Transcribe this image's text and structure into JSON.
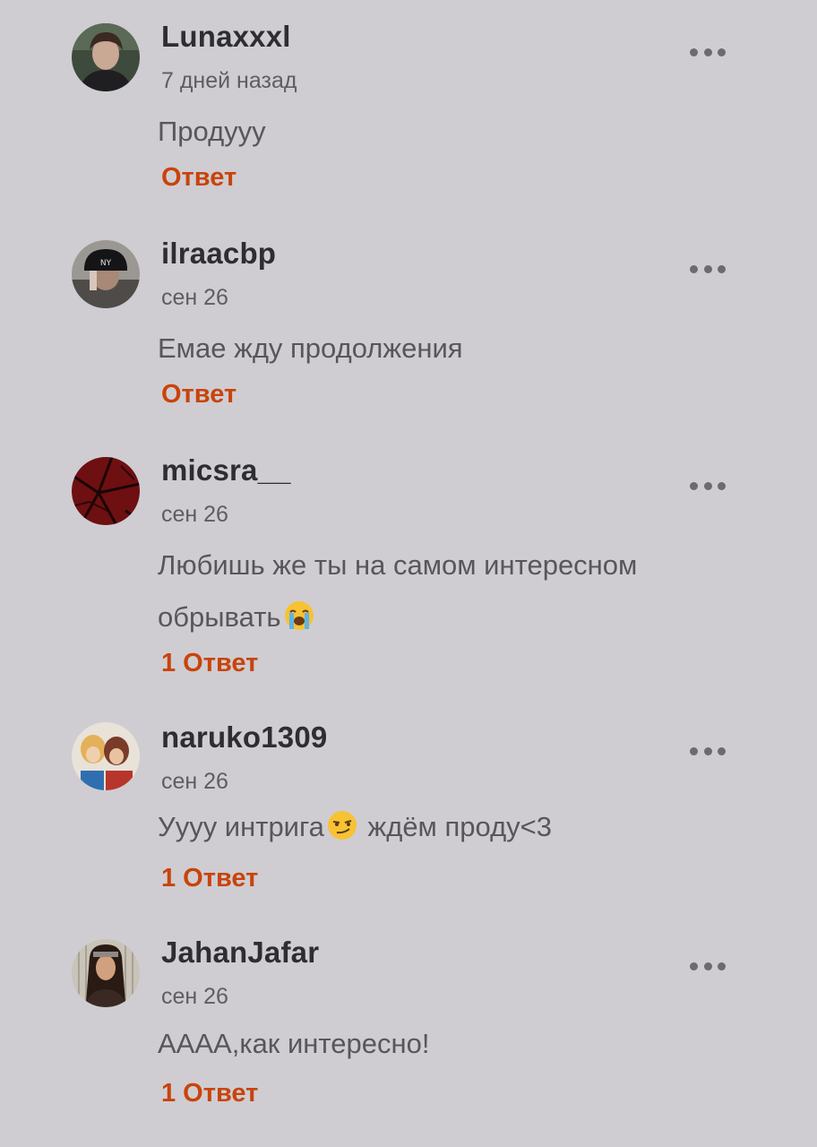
{
  "comments": [
    {
      "username": "Lunaxxxl",
      "time": "7 дней назад",
      "text": "Продууу",
      "emoji": "",
      "text_after": "",
      "reply": "Ответ"
    },
    {
      "username": "ilraacbp",
      "time": "сен 26",
      "text": "Емае жду продолжения",
      "emoji": "",
      "text_after": "",
      "reply": "Ответ"
    },
    {
      "username": "micsra__",
      "time": "сен 26",
      "text": "Любишь же ты на самом интересном обрывать",
      "emoji": "loudly-crying-face-emoji",
      "text_after": "",
      "reply": "1 Ответ"
    },
    {
      "username": "naruko1309",
      "time": "сен 26",
      "text": "Уууу интрига",
      "emoji": "smirking-face-emoji",
      "text_after": " ждём проду<3",
      "reply": "1 Ответ"
    },
    {
      "username": "JahanJafar",
      "time": "сен 26",
      "text": "АААА,как интересно!",
      "emoji": "",
      "text_after": "",
      "reply": "1 Ответ"
    }
  ],
  "colors": {
    "background": "#cfcdd2",
    "username": "#2e2d31",
    "time": "#5f5d63",
    "text": "#58565c",
    "reply_accent": "#c9430a",
    "more_dots": "#6c6a70"
  },
  "icons": {
    "more": "more-horizontal-icon"
  }
}
